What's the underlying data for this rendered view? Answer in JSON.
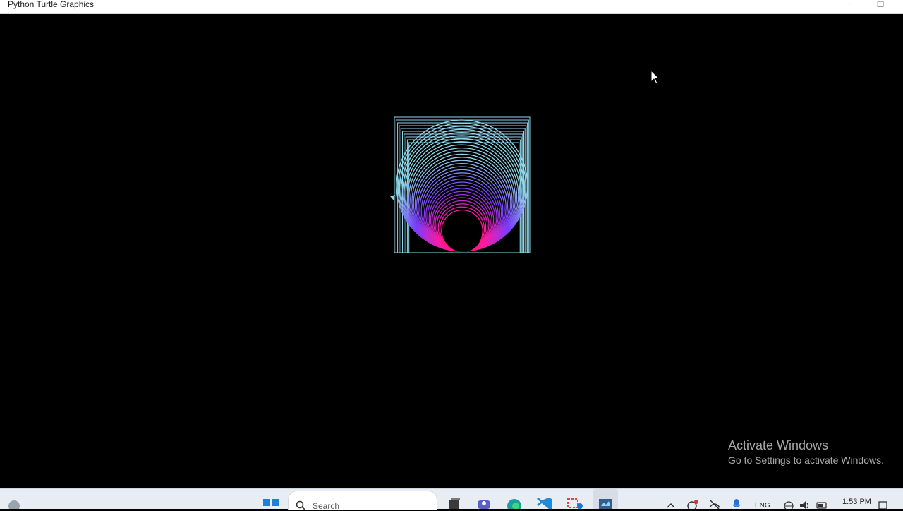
{
  "window": {
    "title": "Python Turtle Graphics",
    "minimize_glyph": "─",
    "restore_glyph": "❐"
  },
  "canvas": {
    "background": "#000000",
    "drawing": {
      "square_color": "#8fd8ea",
      "gradient_colors": [
        "#ff0010",
        "#ff1aa0",
        "#7a3cff",
        "#8fd8ea"
      ],
      "center_hole_color": "#000000"
    }
  },
  "watermark": {
    "line1": "Activate Windows",
    "line2": "Go to Settings to activate Windows."
  },
  "taskbar": {
    "search_placeholder": "Search",
    "language": "ENG",
    "time": "1:53 PM",
    "icons": [
      "widgets-icon",
      "start-icon",
      "search-icon",
      "task-view-icon",
      "teams-icon",
      "edge-icon",
      "vscode-icon",
      "snipping-tool-icon",
      "python-icon"
    ],
    "tray_icons": [
      "chevron-up-icon",
      "sync-icon",
      "network-off-icon",
      "microphone-icon",
      "globe-icon",
      "volume-icon",
      "battery-icon",
      "notification-icon"
    ]
  }
}
